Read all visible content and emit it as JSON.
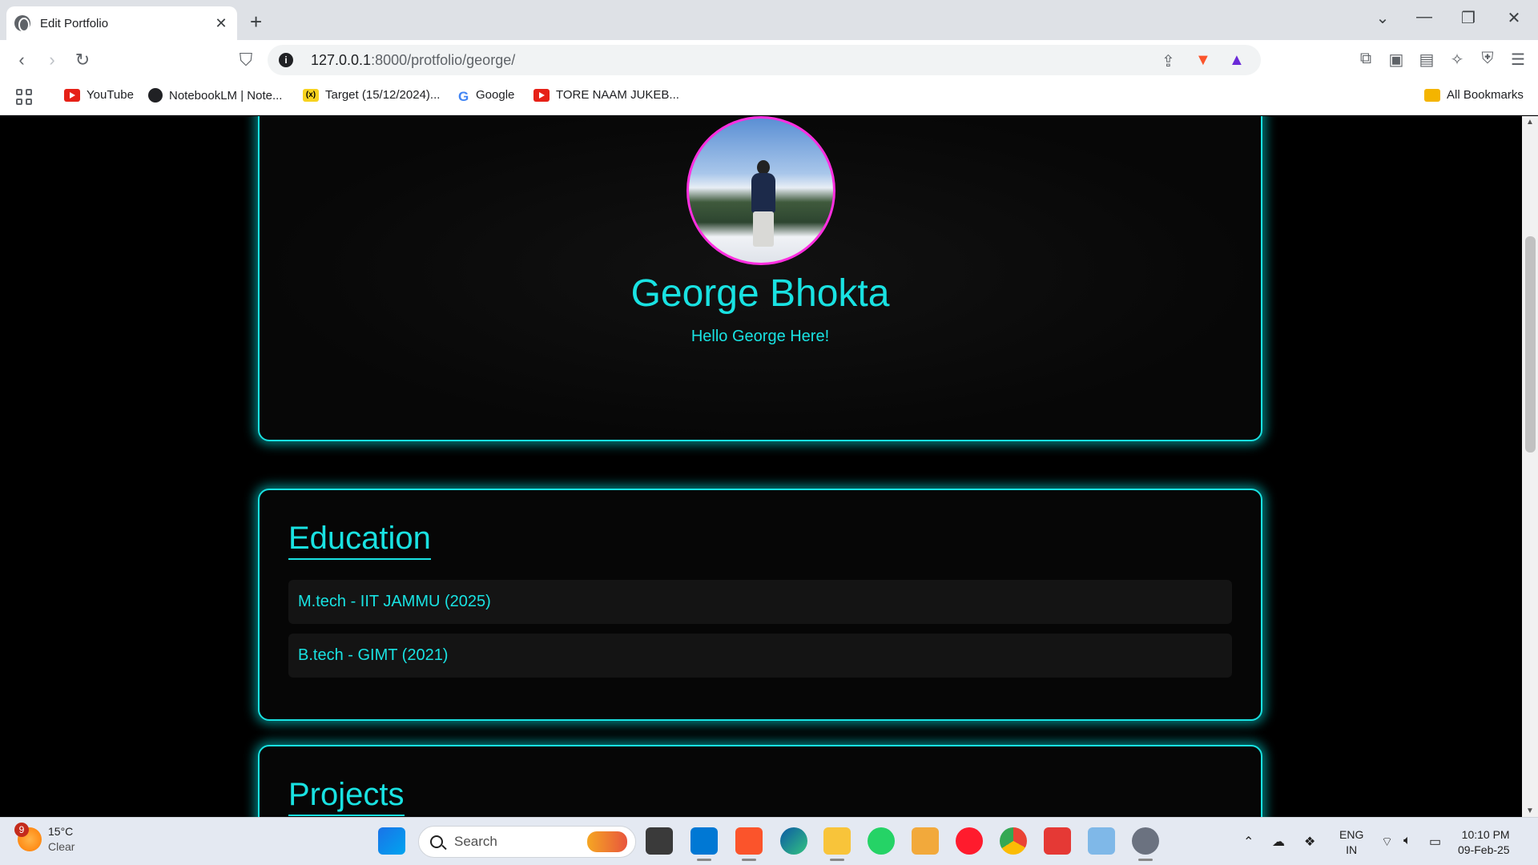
{
  "browser": {
    "tab_title": "Edit Portfolio",
    "tab_close": "✕",
    "new_tab": "+",
    "url_host": "127.0.0.1",
    "url_rest": ":8000/protfolio/george/",
    "bookmarks": [
      {
        "label": "YouTube"
      },
      {
        "label": "NotebookLM | Note..."
      },
      {
        "label": "Target (15/12/2024)..."
      },
      {
        "label": "Google"
      },
      {
        "label": "TORE NAAM JUKEB..."
      }
    ],
    "all_bookmarks": "All Bookmarks"
  },
  "profile": {
    "name": "George Bhokta",
    "tagline": "Hello George Here!"
  },
  "education": {
    "title": "Education",
    "items": [
      {
        "text": "M.tech - IIT JAMMU (2025)"
      },
      {
        "text": "B.tech - GIMT (2021)"
      }
    ]
  },
  "projects": {
    "title": "Projects"
  },
  "taskbar": {
    "weather_badge": "9",
    "temperature": "15°C",
    "condition": "Clear",
    "search_label": "Search",
    "lang_top": "ENG",
    "lang_bottom": "IN",
    "time": "10:10 PM",
    "date": "09-Feb-25"
  },
  "colors": {
    "accent": "#19e2e2",
    "avatar_border": "#ff2fe0",
    "page_bg": "#000000"
  }
}
